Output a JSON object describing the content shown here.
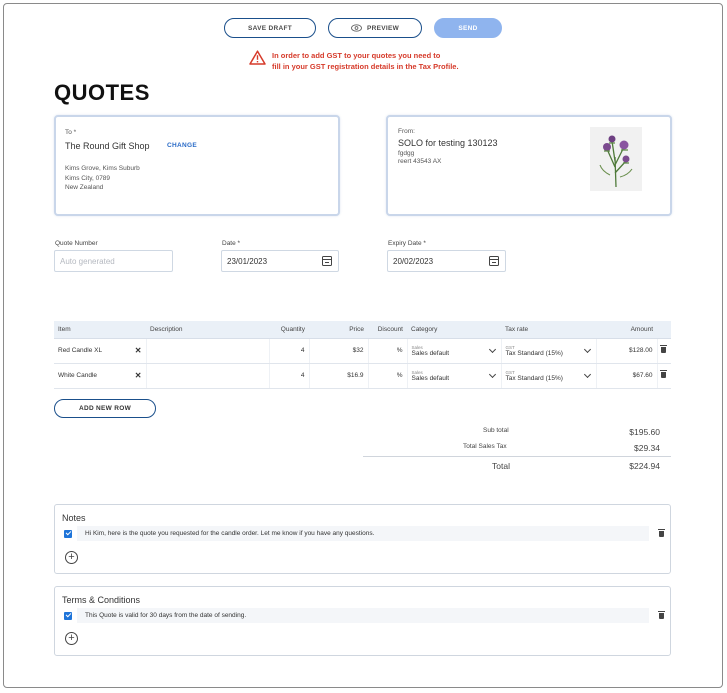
{
  "toolbar": {
    "save_draft_label": "SAVE DRAFT",
    "preview_label": "PREVIEW",
    "send_label": "SEND"
  },
  "warning": {
    "line1": "In order to add GST to your quotes you need to",
    "line2": "fill in your GST registration details in the Tax Profile."
  },
  "page_title": "QUOTES",
  "to_card": {
    "label": "To *",
    "name": "The Round Gift Shop",
    "change_label": "CHANGE",
    "address": [
      "Kims Grove, Kims Suburb",
      "Kims City, 0789",
      "New Zealand"
    ]
  },
  "from_card": {
    "label": "From:",
    "name": "SOLO for testing 130123",
    "line1": "fgdgg",
    "line2": "reert 43543 AX",
    "image_icon": "thistle-flower-image"
  },
  "fields": {
    "quote_number_label": "Quote Number",
    "quote_number_placeholder": "Auto generated",
    "date_label": "Date *",
    "date_value": "23/01/2023",
    "expiry_label": "Expiry Date *",
    "expiry_value": "20/02/2023"
  },
  "table": {
    "headers": [
      "Item",
      "Description",
      "Quantity",
      "Price",
      "Discount",
      "Category",
      "Tax rate",
      "Amount"
    ],
    "rows": [
      {
        "item": "Red Candle XL",
        "description": "",
        "quantity": "4",
        "price": "$32",
        "discount": "%",
        "category_sub": "Sales",
        "category": "Sales default",
        "tax_sub": "GST",
        "tax": "Tax Standard (15%)",
        "amount": "$128.00"
      },
      {
        "item": "White Candle",
        "description": "",
        "quantity": "4",
        "price": "$16.9",
        "discount": "%",
        "category_sub": "Sales",
        "category": "Sales default",
        "tax_sub": "GST",
        "tax": "Tax Standard (15%)",
        "amount": "$67.60"
      }
    ],
    "remove_glyph": "✕"
  },
  "add_row_label": "ADD NEW ROW",
  "totals": {
    "subtotal_label": "Sub total",
    "subtotal_value": "$195.60",
    "tax_label": "Total Sales Tax",
    "tax_value": "$29.34",
    "total_label": "Total",
    "total_value": "$224.94"
  },
  "notes": {
    "title": "Notes",
    "text": "Hi Kim, here is the quote you requested for the candle order.  Let me know if you have any questions."
  },
  "terms": {
    "title": "Terms & Conditions",
    "text": "This Quote is valid for 30 days from the date of sending."
  },
  "colors": {
    "accent": "#1a4f8b",
    "send": "#8fb4ee",
    "warning": "#d63a2a",
    "checkbox": "#1e74d9"
  }
}
